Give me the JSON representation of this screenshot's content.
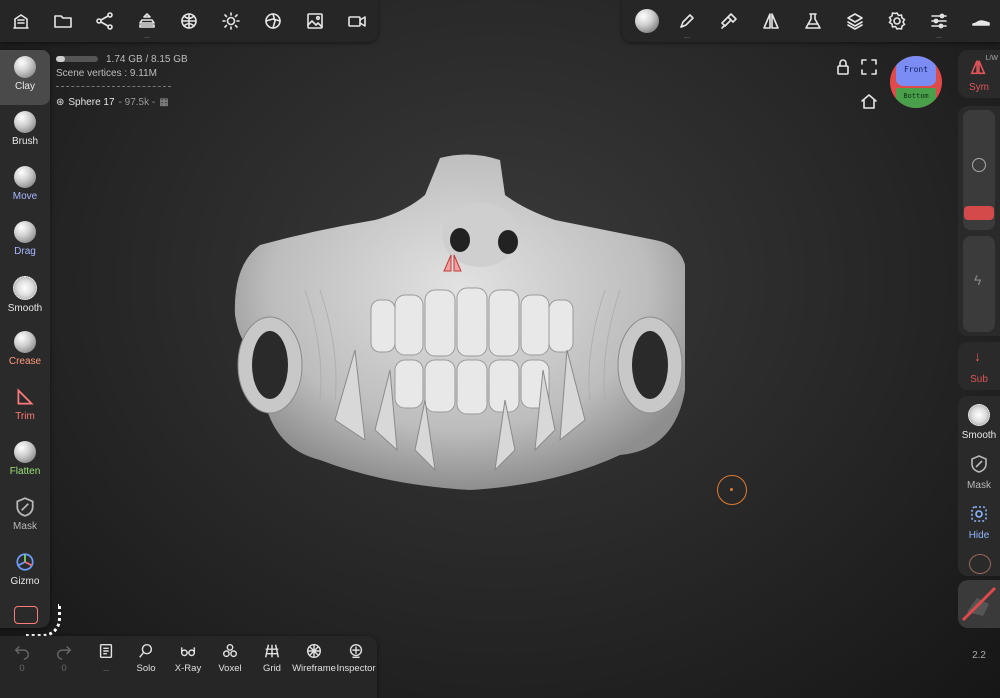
{
  "top_left_toolbar": {
    "icons": [
      "scene-icon",
      "folder-icon",
      "share-graph-icon",
      "stack-icon",
      "mesh-sphere-icon",
      "sun-icon",
      "material-ball-icon",
      "image-icon",
      "camera-icon"
    ]
  },
  "top_right_toolbar": {
    "icons": [
      "material-sphere-icon",
      "brush-pen-icon",
      "paint-icon",
      "symmetry-icon",
      "flask-icon",
      "layers-icon",
      "settings-icon",
      "sliders-icon",
      "shoe-icon"
    ]
  },
  "memory": {
    "text": "1.74 GB / 8.15 GB",
    "usage_fraction": 0.21
  },
  "scene_vertices": "Scene vertices : 9.11M",
  "object": {
    "name": "Sphere 17",
    "detail": "- 97.5k -"
  },
  "view_cube": {
    "front": "Front",
    "bottom": "Bottom"
  },
  "left_tools": [
    {
      "label": "Clay",
      "color": "#e8e8e8"
    },
    {
      "label": "Brush",
      "color": "#e8e8e8"
    },
    {
      "label": "Move",
      "color": "#a9b7ff"
    },
    {
      "label": "Drag",
      "color": "#a9b7ff"
    },
    {
      "label": "Smooth",
      "color": "#e8e8e8"
    },
    {
      "label": "Crease",
      "color": "#ff9a7a"
    },
    {
      "label": "Trim",
      "color": "#ff7a7a"
    },
    {
      "label": "Flatten",
      "color": "#9be07b"
    },
    {
      "label": "Mask",
      "color": "#b8b8b8"
    },
    {
      "label": "Gizmo",
      "color": "#e8e8e8"
    }
  ],
  "right_col": {
    "sym": {
      "label": "Sym",
      "sub": "L/W"
    },
    "sub": {
      "label": "Sub"
    },
    "smooth": {
      "label": "Smooth"
    },
    "mask": {
      "label": "Mask"
    },
    "hide": {
      "label": "Hide"
    },
    "version": "2.2"
  },
  "bottom_bar": {
    "undo_count": "0",
    "redo_count": "0",
    "items": [
      {
        "label": "Solo"
      },
      {
        "label": "X-Ray"
      },
      {
        "label": "Voxel"
      },
      {
        "label": "Grid"
      },
      {
        "label": "Wireframe"
      },
      {
        "label": "Inspector"
      }
    ]
  },
  "colors": {
    "accent_orange": "#e07a2f",
    "symmetry_red": "#e0555a",
    "viewcube_blue": "#7b8cf5",
    "viewcube_green": "#4aa04a",
    "viewcube_red": "#e04a4a"
  }
}
